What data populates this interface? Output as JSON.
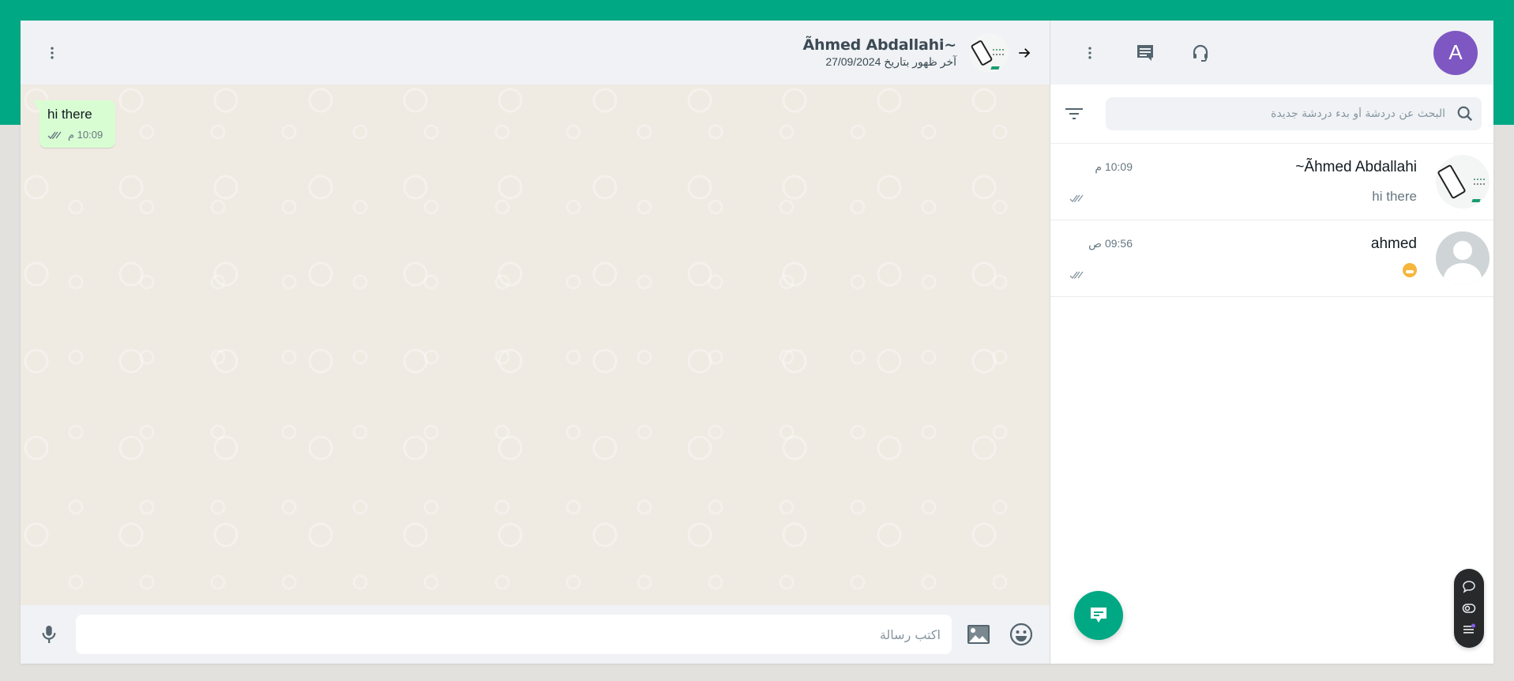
{
  "colors": {
    "brand": "#00a884",
    "bubble_out": "#d9fdd3",
    "avatar_bg": "#7e57c2",
    "panel_bg": "#f0f2f5",
    "chat_bg": "#efeae2"
  },
  "chat": {
    "header": {
      "contact_name": "Ãhmed Abdallahi~",
      "last_seen": "آخر ظهور بتاريخ 27/09/2024",
      "back_icon": "arrow-right-icon",
      "menu_icon": "more-vertical-icon"
    },
    "messages": [
      {
        "text": "hi there",
        "time": "10:09 م",
        "status": "read-double-check",
        "direction": "outgoing"
      }
    ],
    "compose": {
      "placeholder": "اكتب رسالة",
      "value": "",
      "icons": [
        "emoji-icon",
        "image-icon",
        "mic-icon"
      ]
    }
  },
  "sidebar": {
    "header": {
      "avatar_letter": "A",
      "icons": [
        "support-headset-icon",
        "new-chat-icon",
        "more-vertical-icon"
      ]
    },
    "search": {
      "placeholder": "البحث عن دردشة أو بدء دردشة جديدة",
      "value": ""
    },
    "chats": [
      {
        "name": "~Ãhmed Abdallahi",
        "last_message": "hi there",
        "time": "10:09 م",
        "status": "double-check",
        "avatar": "image"
      },
      {
        "name": "ahmed",
        "last_message": "😬",
        "time": "09:56 ص",
        "status": "double-check",
        "avatar": "default"
      }
    ],
    "fab_icon": "new-message-icon",
    "floating_tools": [
      "chat-bubble-icon",
      "eye-icon",
      "list-icon"
    ]
  }
}
